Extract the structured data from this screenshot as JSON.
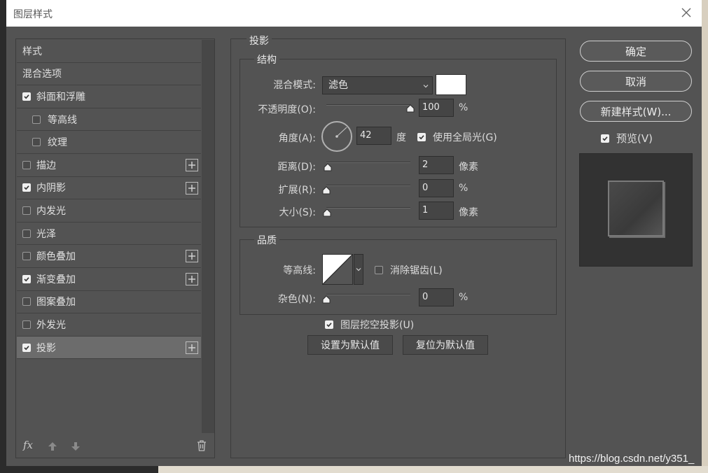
{
  "window": {
    "title": "图层样式"
  },
  "sidebar": {
    "items": [
      {
        "label": "样式"
      },
      {
        "label": "混合选项"
      },
      {
        "label": "斜面和浮雕"
      },
      {
        "label": "等高线"
      },
      {
        "label": "纹理"
      },
      {
        "label": "描边"
      },
      {
        "label": "内阴影"
      },
      {
        "label": "内发光"
      },
      {
        "label": "光泽"
      },
      {
        "label": "颜色叠加"
      },
      {
        "label": "渐变叠加"
      },
      {
        "label": "图案叠加"
      },
      {
        "label": "外发光"
      },
      {
        "label": "投影"
      }
    ],
    "footer": {
      "fx_label": "fx"
    }
  },
  "panel": {
    "title": "投影",
    "structure": {
      "title": "结构",
      "blend_mode_label": "混合模式:",
      "blend_mode_value": "滤色",
      "blend_color": "#ffffff",
      "opacity_label": "不透明度(O):",
      "opacity_value": "100",
      "opacity_unit": "%",
      "angle_label": "角度(A):",
      "angle_value": "42",
      "angle_unit": "度",
      "global_light_label": "使用全局光(G)",
      "distance_label": "距离(D):",
      "distance_value": "2",
      "distance_unit": "像素",
      "spread_label": "扩展(R):",
      "spread_value": "0",
      "spread_unit": "%",
      "size_label": "大小(S):",
      "size_value": "1",
      "size_unit": "像素"
    },
    "quality": {
      "title": "品质",
      "contour_label": "等高线:",
      "anti_alias_label": "消除锯齿(L)",
      "noise_label": "杂色(N):",
      "noise_value": "0",
      "noise_unit": "%"
    },
    "knockout_label": "图层挖空投影(U)",
    "make_default_label": "设置为默认值",
    "reset_default_label": "复位为默认值"
  },
  "actions": {
    "ok_label": "确定",
    "cancel_label": "取消",
    "new_style_label": "新建样式(W)...",
    "preview_label": "预览(V)"
  },
  "watermark": "https://blog.csdn.net/y351_"
}
